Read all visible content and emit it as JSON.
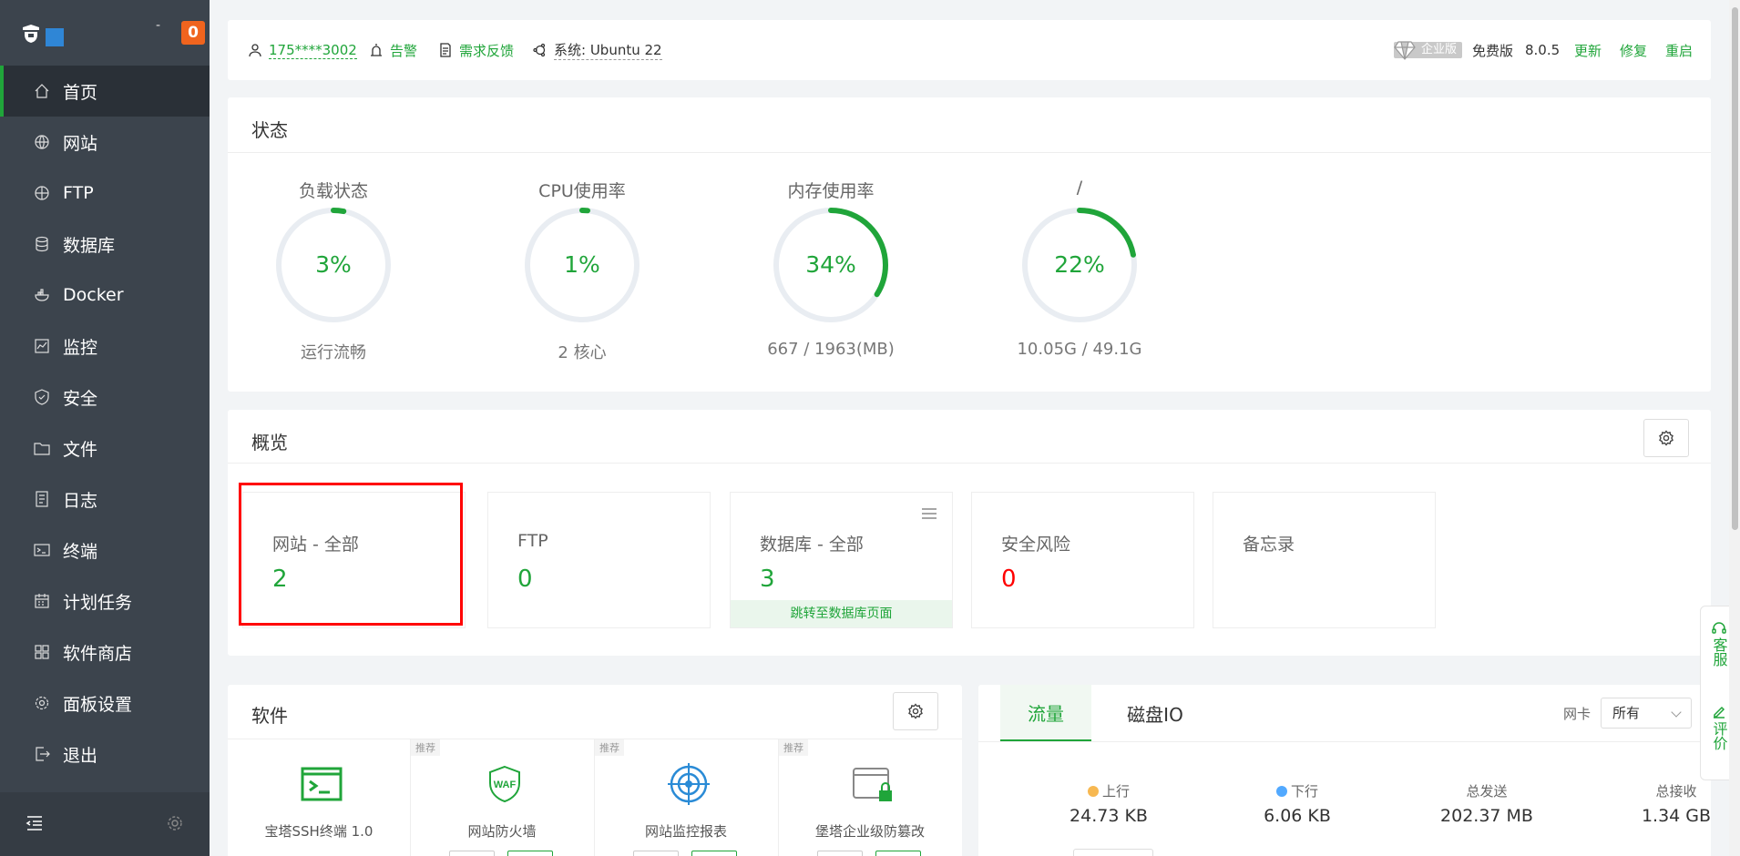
{
  "sidebar": {
    "dash": "-",
    "badge": "0",
    "items": [
      {
        "label": "首页",
        "icon": "home-icon",
        "active": true
      },
      {
        "label": "网站",
        "icon": "globe-icon"
      },
      {
        "label": "FTP",
        "icon": "ftp-icon"
      },
      {
        "label": "数据库",
        "icon": "database-icon"
      },
      {
        "label": "Docker",
        "icon": "docker-icon"
      },
      {
        "label": "监控",
        "icon": "monitor-icon"
      },
      {
        "label": "安全",
        "icon": "shield-icon"
      },
      {
        "label": "文件",
        "icon": "folder-icon"
      },
      {
        "label": "日志",
        "icon": "log-icon"
      },
      {
        "label": "终端",
        "icon": "terminal-icon"
      },
      {
        "label": "计划任务",
        "icon": "calendar-icon"
      },
      {
        "label": "软件商店",
        "icon": "grid-icon"
      },
      {
        "label": "面板设置",
        "icon": "gear-icon"
      },
      {
        "label": "退出",
        "icon": "logout-icon"
      }
    ]
  },
  "topbar": {
    "user": "175****3002",
    "alarm": "告警",
    "feedback": "需求反馈",
    "system": "系统: Ubuntu 22",
    "enterprise": "企业版",
    "free": "免费版",
    "version": "8.0.5",
    "update": "更新",
    "repair": "修复",
    "restart": "重启"
  },
  "status": {
    "title": "状态",
    "gauges": [
      {
        "label": "负载状态",
        "value": "3%",
        "percent": 3,
        "sub": "运行流畅"
      },
      {
        "label": "CPU使用率",
        "value": "1%",
        "percent": 1,
        "sub": "2 核心"
      },
      {
        "label": "内存使用率",
        "value": "34%",
        "percent": 34,
        "sub": "667 / 1963(MB)"
      },
      {
        "label": "/",
        "value": "22%",
        "percent": 22,
        "sub": "10.05G / 49.1G"
      }
    ]
  },
  "overview": {
    "title": "概览",
    "boxes": [
      {
        "label": "网站 - 全部",
        "value": "2"
      },
      {
        "label": "FTP",
        "value": "0"
      },
      {
        "label": "数据库 - 全部",
        "value": "3",
        "link": "跳转至数据库页面"
      },
      {
        "label": "安全风险",
        "value": "0"
      },
      {
        "label": "备忘录",
        "value": ""
      }
    ]
  },
  "software": {
    "title": "软件",
    "items": [
      {
        "name": "宝塔SSH终端 1.0",
        "tag": ""
      },
      {
        "name": "网站防火墙",
        "tag": "推荐"
      },
      {
        "name": "网站监控报表",
        "tag": "推荐"
      },
      {
        "name": "堡塔企业级防篡改",
        "tag": "推荐"
      }
    ]
  },
  "traffic": {
    "tabs": [
      "流量",
      "磁盘IO"
    ],
    "nic_label": "网卡",
    "nic_value": "所有",
    "stats": [
      {
        "label": "上行",
        "value": "24.73 KB",
        "color": "#f7b851"
      },
      {
        "label": "下行",
        "value": "6.06 KB",
        "color": "#52a9ff"
      },
      {
        "label": "总发送",
        "value": "202.37 MB"
      },
      {
        "label": "总接收",
        "value": "1.34 GB"
      }
    ]
  },
  "float": {
    "service": "客服",
    "review": "评价"
  },
  "colors": {
    "accent": "#20a53a",
    "sidebar": "#3c444d",
    "danger": "#ff0000"
  }
}
